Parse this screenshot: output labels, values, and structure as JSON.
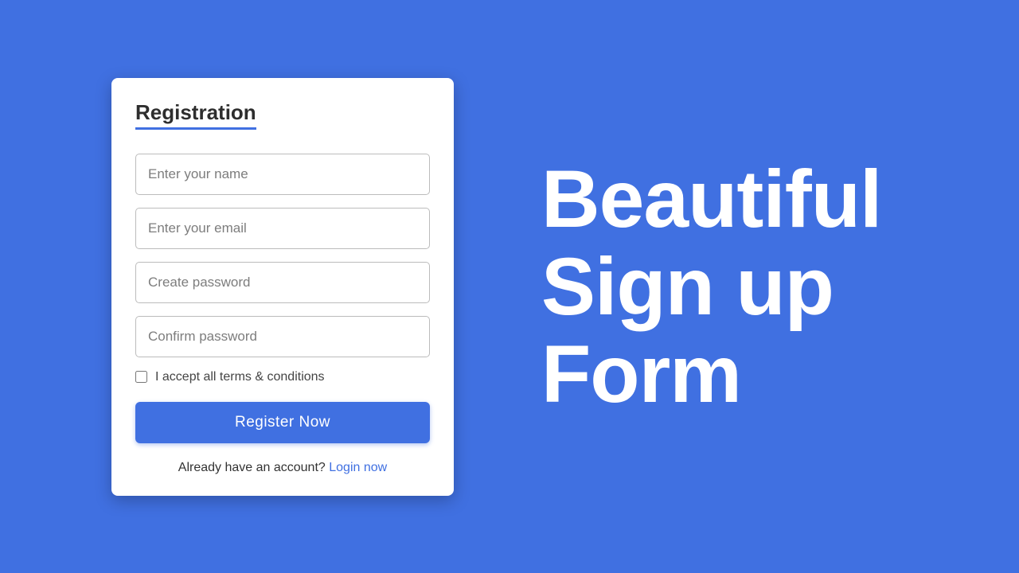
{
  "form": {
    "title": "Registration",
    "fields": {
      "name": {
        "placeholder": "Enter your name"
      },
      "email": {
        "placeholder": "Enter your email"
      },
      "password": {
        "placeholder": "Create password"
      },
      "confirm": {
        "placeholder": "Confirm password"
      }
    },
    "terms_label": "I accept all terms & conditions",
    "submit_label": "Register Now",
    "footer_text": "Already have an account? ",
    "footer_link": "Login now"
  },
  "hero": {
    "line1": "Beautiful",
    "line2": "Sign up",
    "line3": "Form"
  }
}
